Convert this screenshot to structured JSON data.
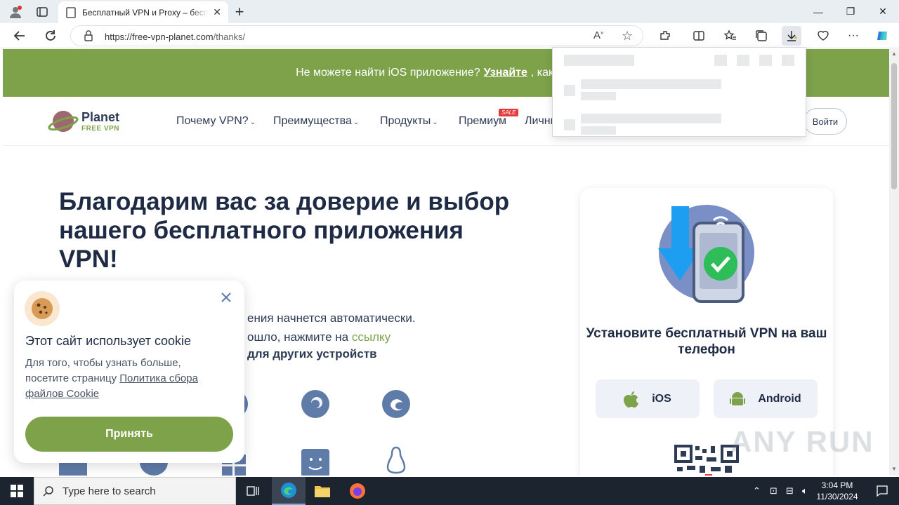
{
  "browser": {
    "tab_title": "Бесплатный VPN и Proxy – бесплатный VPN",
    "url_main": "https://free-vpn-planet.com",
    "url_path": "/thanks/"
  },
  "page": {
    "banner": {
      "text_before": "Не можете найти iOS приложение?",
      "link": "Узнайте",
      "text_after": ", как скачать"
    },
    "logo": {
      "line1": "Planet",
      "line2": "FREE VPN"
    },
    "menu": [
      "Почему VPN?",
      "Преимущества",
      "Продукты",
      "Премиум",
      "Личный кабинет"
    ],
    "sale_badge": "SALE",
    "login": "Войти",
    "headline": "Благодарим вас за доверие и выбор нашего бесплатного приложения VPN!",
    "line1": "ения начнется автоматически.",
    "line2_pre": "ошло, нажмите на",
    "line2_link": "ссылку",
    "line3": "для других устройств",
    "card": {
      "title": "Установите бесплатный VPN на ваш телефон",
      "ios": "iOS",
      "android": "Android"
    }
  },
  "cookie": {
    "title": "Этот сайт использует cookie",
    "text_pre": "Для того, чтобы узнать больше, посетите страницу",
    "text_link": "Политика сбора файлов Cookie",
    "accept": "Принять"
  },
  "taskbar": {
    "search_placeholder": "Type here to search",
    "time": "3:04 PM",
    "date": "11/30/2024"
  },
  "watermark": "ANY RUN",
  "colors": {
    "brand_green": "#7da24a",
    "navy": "#1f2b44"
  }
}
